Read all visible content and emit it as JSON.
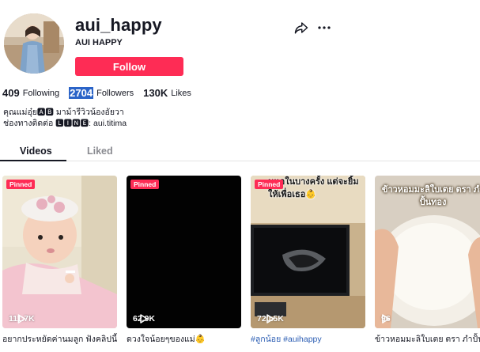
{
  "profile": {
    "username": "aui_happy",
    "nickname": "AUI HAPPY",
    "follow_label": "Follow"
  },
  "header_icons": [
    "share-icon",
    "more-icon"
  ],
  "stats": {
    "following_count": "409",
    "following_label": "Following",
    "followers_count": "2704",
    "followers_label": "Followers",
    "likes_count": "130K",
    "likes_label": "Likes"
  },
  "bio": {
    "line1": "คุณแม่อุ๋ย🅰🅱 มาม้ารีวิวน้องอัยวา",
    "line2": "ช่องทางติดต่อ 🅻🅸🅽🅴: aui.titima"
  },
  "tabs": {
    "videos": "Videos",
    "liked": "Liked",
    "active": "videos"
  },
  "colors": {
    "accent": "#fe2c55",
    "text": "#161823",
    "muted": "#8a8b91",
    "hashtag": "#2b5db3"
  },
  "videos": [
    {
      "pinned": "Pinned",
      "views": "111.7K",
      "caption": "อยากประหยัดค่านมลูก ฟังคลิปนี้",
      "overlay": ""
    },
    {
      "pinned": "Pinned",
      "views": "62.9K",
      "caption": "ดวงใจน้อยๆของแม่👶",
      "overlay": ""
    },
    {
      "pinned": "Pinned",
      "views": "720.5K",
      "caption": "#ลูกน้อย #auihappy",
      "overlay": "นแอในบางครั้ง แต่จะยิ้มให้เพื่อเธอ👶"
    },
    {
      "pinned": "",
      "views": "96",
      "caption": "ข้าวหอมมะลิใบเตย ตรา ภำปั้น",
      "overlay": "ข้าวหอมมะลิใบเตย ตรา ภำปั้นทอง"
    }
  ]
}
